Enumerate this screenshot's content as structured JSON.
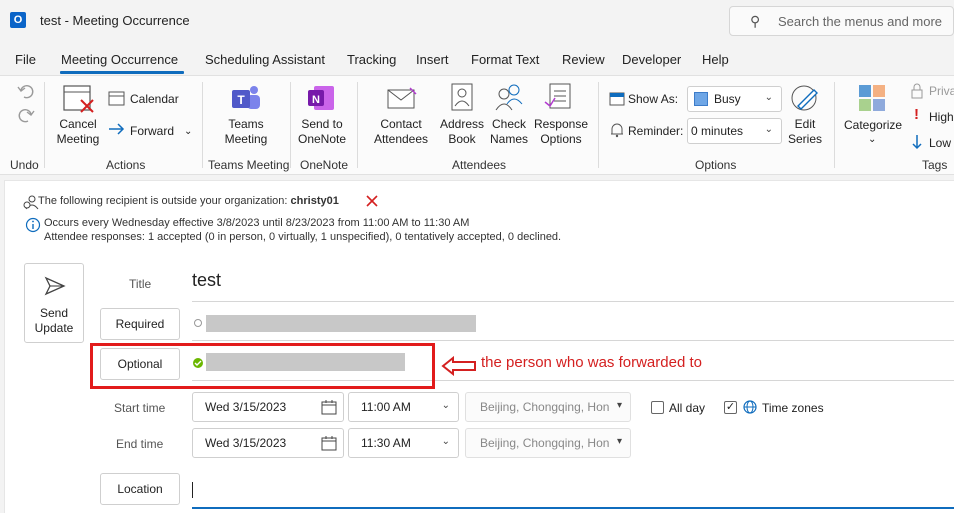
{
  "window": {
    "title": "test  -  Meeting Occurrence",
    "app_icon_letter": "O",
    "search_placeholder": "Search the menus and more"
  },
  "menu": {
    "items": [
      "File",
      "Meeting Occurrence",
      "Scheduling Assistant",
      "Tracking",
      "Insert",
      "Format Text",
      "Review",
      "Developer",
      "Help"
    ]
  },
  "ribbon": {
    "undo_label": "Undo",
    "cancel_meeting": "Cancel\nMeeting",
    "calendar": "Calendar",
    "forward": "Forward",
    "actions_label": "Actions",
    "teams_meeting": "Teams\nMeeting",
    "teams_group": "Teams Meeting",
    "send_to_onenote": "Send to\nOneNote",
    "onenote_group": "OneNote",
    "contact_attendees": "Contact\nAttendees",
    "address_book": "Address\nBook",
    "check_names": "Check\nNames",
    "response_options": "Response\nOptions",
    "attendees_group": "Attendees",
    "show_as_label": "Show As:",
    "show_as_value": "Busy",
    "reminder_label": "Reminder:",
    "reminder_value": "0 minutes",
    "edit_series": "Edit\nSeries",
    "options_group": "Options",
    "categorize": "Categorize",
    "private": "Priva",
    "high": "High",
    "low": "Low",
    "tags_group": "Tags",
    "busy_color": "#6ea6e6"
  },
  "info": {
    "outside_prefix": "The following recipient is outside your organization:",
    "outside_name": "christy01",
    "occurs": "Occurs every Wednesday effective 3/8/2023 until 8/23/2023 from 11:00 AM to 11:30 AM",
    "responses": "Attendee responses: 1 accepted (0 in person, 0 virtually, 1 unspecified), 0 tentatively accepted, 0 declined."
  },
  "form": {
    "send_update": "Send\nUpdate",
    "title_label": "Title",
    "title_value": "test",
    "required_label": "Required",
    "optional_label": "Optional",
    "start_label": "Start time",
    "end_label": "End time",
    "start_date": "Wed 3/15/2023",
    "start_time": "11:00 AM",
    "end_date": "Wed 3/15/2023",
    "end_time": "11:30 AM",
    "timezone": "Beijing, Chongqing, Hon",
    "all_day": "All day",
    "time_zones": "Time zones",
    "location_label": "Location"
  },
  "annotation": {
    "text": "the person who was forwarded to",
    "color": "#d42020"
  }
}
